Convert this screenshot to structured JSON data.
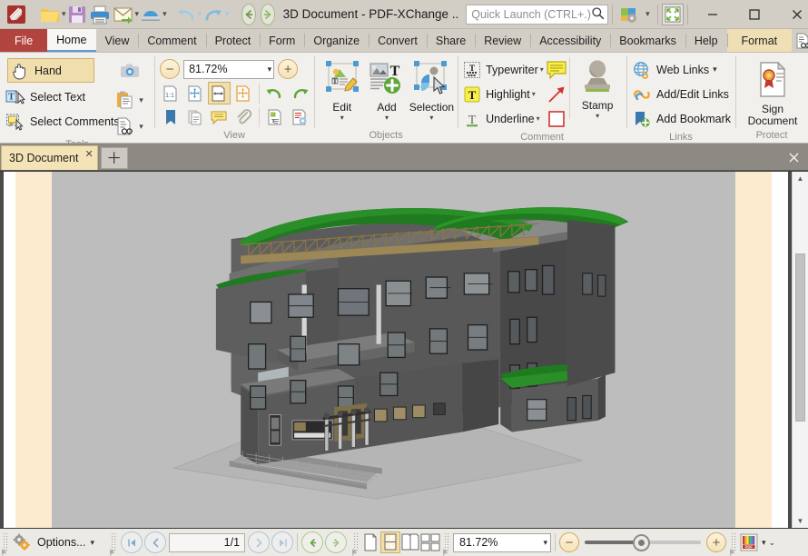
{
  "app": {
    "title": "3D Document - PDF-XChange ..",
    "logo_icon": "pdf-xchange-logo-icon"
  },
  "titlebar": {
    "open_icon": "open-folder-icon",
    "open_caret": "chevron-down-icon",
    "save_icon": "save-floppy-icon",
    "print_icon": "printer-icon",
    "email_icon": "email-send-icon",
    "email_caret": "chevron-down-icon",
    "scan_icon": "scanner-icon",
    "scan_caret": "chevron-down-icon",
    "undo_icon": "undo-arrow-icon",
    "undo_caret": "chevron-down-icon",
    "redo_icon": "redo-arrow-icon",
    "redo_caret": "chevron-down-icon",
    "back_icon": "back-arrow-icon",
    "forward_icon": "forward-arrow-icon",
    "customize_icon": "customize-toolbar-icon",
    "customize_caret": "chevron-down-icon",
    "fullscreen_icon": "fullscreen-icon",
    "minimize_icon": "minimize-icon",
    "maximize_icon": "maximize-icon",
    "close_icon": "close-icon"
  },
  "search": {
    "placeholder": "Quick Launch (CTRL+.)",
    "icon": "search-icon"
  },
  "ribbon": {
    "tabs": [
      {
        "label": "File",
        "kind": "file"
      },
      {
        "label": "Home",
        "kind": "active"
      },
      {
        "label": "View",
        "kind": "normal"
      },
      {
        "label": "Comment",
        "kind": "normal"
      },
      {
        "label": "Protect",
        "kind": "normal"
      },
      {
        "label": "Form",
        "kind": "normal"
      },
      {
        "label": "Organize",
        "kind": "normal"
      },
      {
        "label": "Convert",
        "kind": "normal"
      },
      {
        "label": "Share",
        "kind": "normal"
      },
      {
        "label": "Review",
        "kind": "normal"
      },
      {
        "label": "Accessibility",
        "kind": "normal"
      },
      {
        "label": "Bookmarks",
        "kind": "normal"
      },
      {
        "label": "Help",
        "kind": "normal"
      },
      {
        "label": "Format",
        "kind": "format"
      }
    ],
    "right_icons": [
      "document-find-icon",
      "folder-find-icon",
      "collapse-ribbon-icon"
    ],
    "groups": {
      "tools": {
        "label": "Tools",
        "hand": "Hand",
        "select_text": "Select Text",
        "select_comments": "Select Comments",
        "hand_icon": "hand-icon",
        "select_text_icon": "select-text-icon",
        "select_comments_icon": "select-comments-icon",
        "snapshot_icon": "camera-snapshot-icon",
        "clipboard_icon": "clipboard-paste-icon",
        "clipboard_caret": "chevron-down-icon",
        "find_icon": "document-find-icon",
        "find_caret": "chevron-down-icon"
      },
      "view": {
        "label": "View",
        "zoom_value": "81.72%",
        "zoom_out_icon": "zoom-out-icon",
        "zoom_in_icon": "zoom-in-icon",
        "zoom_caret": "chevron-down-icon",
        "actual_size_icon": "actual-size-icon",
        "fit_page_icon": "fit-page-icon",
        "fit_width_icon": "fit-width-icon",
        "fit_visible_icon": "fit-visible-icon",
        "rotate_left_icon": "rotate-left-icon",
        "rotate_right_icon": "rotate-right-icon",
        "bookmarks_pane_icon": "bookmarks-pane-icon",
        "thumbnails_pane_icon": "thumbnails-pane-icon",
        "comments_pane_icon": "comments-pane-icon",
        "attachments_pane_icon": "attachments-pane-icon",
        "content_pane_icon": "content-pane-icon",
        "properties_icon": "properties-icon"
      },
      "objects": {
        "label": "Objects",
        "edit": "Edit",
        "add": "Add",
        "selection": "Selection",
        "edit_icon": "edit-content-icon",
        "add_icon": "add-content-icon",
        "selection_icon": "selection-tool-icon",
        "caret": "chevron-down-icon"
      },
      "comment": {
        "label": "Comment",
        "typewriter": "Typewriter",
        "highlight": "Highlight",
        "underline": "Underline",
        "stamp": "Stamp",
        "typewriter_icon": "typewriter-icon",
        "highlight_icon": "highlight-icon",
        "underline_icon": "underline-icon",
        "sticky_note_icon": "sticky-note-icon",
        "arrow_icon": "arrow-annotation-icon",
        "rectangle_icon": "rectangle-annotation-icon",
        "stamp_icon": "stamp-icon",
        "caret": "chevron-down-icon"
      },
      "links": {
        "label": "Links",
        "web_links": "Web Links",
        "add_edit_links": "Add/Edit Links",
        "add_bookmark": "Add Bookmark",
        "web_links_icon": "web-links-globe-icon",
        "add_edit_links_icon": "chain-link-icon",
        "add_bookmark_icon": "add-bookmark-icon",
        "caret": "chevron-down-icon"
      },
      "protect": {
        "label": "Protect",
        "sign_document_line1": "Sign",
        "sign_document_line2": "Document",
        "sign_icon": "sign-document-icon"
      }
    }
  },
  "doctabs": {
    "tabs": [
      {
        "label": "3D Document",
        "close_icon": "close-icon"
      }
    ],
    "new_tab_icon": "plus-icon",
    "close_all_icon": "close-icon"
  },
  "document": {
    "model_name": "3d-architectural-building-model",
    "canvas_bg": "#bdbdbd",
    "page_band_color": "#fcebcf"
  },
  "statusbar": {
    "options_label": "Options...",
    "options_icon": "gears-options-icon",
    "options_caret": "chevron-down-icon",
    "first_page_icon": "first-page-icon",
    "prev_page_icon": "prev-page-icon",
    "page_value": "1/1",
    "page_current": "1",
    "page_total": "1",
    "next_page_icon": "next-page-icon",
    "last_page_icon": "last-page-icon",
    "nav_back_icon": "back-arrow-icon",
    "nav_forward_icon": "forward-arrow-icon",
    "single_page_icon": "single-page-view-icon",
    "single_page_continuous_icon": "single-page-continuous-icon",
    "two_page_icon": "two-page-view-icon",
    "two_page_continuous_icon": "two-page-continuous-icon",
    "zoom_value": "81.72%",
    "zoom_caret": "chevron-down-icon",
    "zoom_out_icon": "zoom-out-icon",
    "zoom_in_icon": "zoom-in-icon",
    "theme_icon": "pdf-theme-icon",
    "theme_caret": "chevron-down-icon",
    "collapse_icon": "collapse-icon"
  },
  "scrollbar": {
    "up_icon": "scroll-up-icon",
    "down_icon": "scroll-down-icon",
    "thumb": "scroll-thumb"
  }
}
